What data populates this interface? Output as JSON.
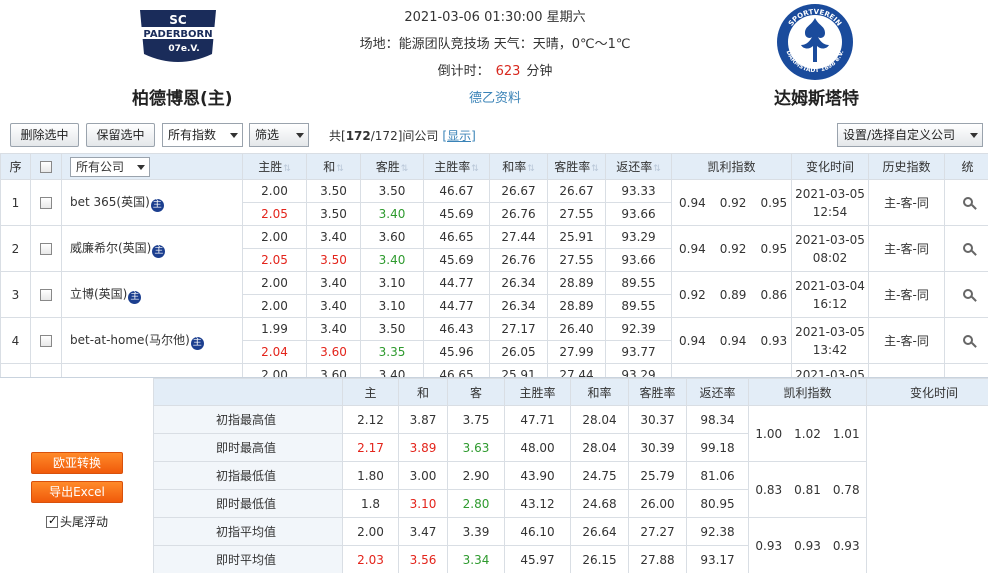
{
  "match": {
    "datetime": "2021-03-06 01:30:00 星期六",
    "venue_weather": "场地：能源团队竞技场 天气：天晴，0℃～1℃",
    "countdown_label": "倒计时：",
    "countdown_value": "623",
    "countdown_unit": "分钟",
    "league_link": "德乙资料",
    "home_team": "柏德博恩(主)",
    "away_team": "达姆斯塔特",
    "home_logo_text": [
      "SC",
      "PADERBORN",
      "07e.V."
    ],
    "away_logo_text": [
      "SPORTVEREIN",
      "DARMSTADT 1898 e.V."
    ]
  },
  "toolbar": {
    "delete_selected": "删除选中",
    "keep_selected": "保留选中",
    "index_select": "所有指数",
    "filter": "筛选",
    "count_prefix": "共[",
    "count_current": "172",
    "count_total": "/172]间公司",
    "show_link": "[显示]",
    "custom_company": "设置/选择自定义公司"
  },
  "table": {
    "headers": {
      "seq": "序",
      "company_dropdown": "所有公司",
      "home_win": "主胜",
      "draw": "和",
      "away_win": "客胜",
      "home_rate": "主胜率",
      "draw_rate": "和率",
      "away_rate": "客胜率",
      "return_rate": "返还率",
      "kelly": "凯利指数",
      "change_time": "变化时间",
      "history": "历史指数",
      "stat": "统"
    },
    "host_badge": "主",
    "rows": [
      {
        "seq": "1",
        "company": "bet 365(英国)",
        "initial": [
          "2.00",
          "3.50",
          "3.50",
          "46.67",
          "26.67",
          "26.67",
          "93.33"
        ],
        "live": [
          "2.05",
          "3.50",
          "3.40",
          "45.69",
          "26.76",
          "27.55",
          "93.66"
        ],
        "live_colors": [
          "red",
          "",
          "green"
        ],
        "kelly": [
          "0.94",
          "0.92",
          "0.95"
        ],
        "date": "2021-03-05",
        "time": "12:54",
        "history": "主-客-同"
      },
      {
        "seq": "2",
        "company": "威廉希尔(英国)",
        "initial": [
          "2.00",
          "3.40",
          "3.60",
          "46.65",
          "27.44",
          "25.91",
          "93.29"
        ],
        "live": [
          "2.05",
          "3.50",
          "3.40",
          "45.69",
          "26.76",
          "27.55",
          "93.66"
        ],
        "live_colors": [
          "red",
          "red",
          "green"
        ],
        "kelly": [
          "0.94",
          "0.92",
          "0.95"
        ],
        "date": "2021-03-05",
        "time": "08:02",
        "history": "主-客-同"
      },
      {
        "seq": "3",
        "company": "立博(英国)",
        "initial": [
          "2.00",
          "3.40",
          "3.10",
          "44.77",
          "26.34",
          "28.89",
          "89.55"
        ],
        "live": [
          "2.00",
          "3.40",
          "3.10",
          "44.77",
          "26.34",
          "28.89",
          "89.55"
        ],
        "live_colors": [
          "",
          "",
          ""
        ],
        "kelly": [
          "0.92",
          "0.89",
          "0.86"
        ],
        "date": "2021-03-04",
        "time": "16:12",
        "history": "主-客-同"
      },
      {
        "seq": "4",
        "company": "bet-at-home(马尔他)",
        "initial": [
          "1.99",
          "3.40",
          "3.50",
          "46.43",
          "27.17",
          "26.40",
          "92.39"
        ],
        "live": [
          "2.04",
          "3.60",
          "3.35",
          "45.96",
          "26.05",
          "27.99",
          "93.77"
        ],
        "live_colors": [
          "red",
          "red",
          "green"
        ],
        "kelly": [
          "0.94",
          "0.94",
          "0.93"
        ],
        "date": "2021-03-05",
        "time": "13:42",
        "history": "主-客-同"
      }
    ],
    "partial_row": [
      "2.00",
      "3.60",
      "3.40",
      "46.65",
      "25.91",
      "27.44",
      "93.29",
      "2021-03-05"
    ]
  },
  "side": {
    "eu_asia": "欧亚转换",
    "export_excel": "导出Excel",
    "float_label": "头尾浮动"
  },
  "summary": {
    "headers": {
      "home": "主",
      "draw": "和",
      "away": "客",
      "home_rate": "主胜率",
      "draw_rate": "和率",
      "away_rate": "客胜率",
      "return_rate": "返还率",
      "kelly": "凯利指数",
      "change_time": "变化时间"
    },
    "rows": [
      {
        "label": "初指最高值",
        "values": [
          "2.12",
          "3.87",
          "3.75",
          "47.71",
          "28.04",
          "30.37",
          "98.34"
        ],
        "colors": [
          "",
          "",
          ""
        ]
      },
      {
        "label": "即时最高值",
        "values": [
          "2.17",
          "3.89",
          "3.63",
          "48.00",
          "28.04",
          "30.39",
          "99.18"
        ],
        "colors": [
          "red",
          "red",
          "green"
        ]
      },
      {
        "label": "初指最低值",
        "values": [
          "1.80",
          "3.00",
          "2.90",
          "43.90",
          "24.75",
          "25.79",
          "81.06"
        ],
        "colors": [
          "",
          "",
          ""
        ]
      },
      {
        "label": "即时最低值",
        "values": [
          "1.8",
          "3.10",
          "2.80",
          "43.12",
          "24.68",
          "26.00",
          "80.95"
        ],
        "colors": [
          "",
          "red",
          "green"
        ]
      },
      {
        "label": "初指平均值",
        "values": [
          "2.00",
          "3.47",
          "3.39",
          "46.10",
          "26.64",
          "27.27",
          "92.38"
        ],
        "colors": [
          "",
          "",
          ""
        ]
      },
      {
        "label": "即时平均值",
        "values": [
          "2.03",
          "3.56",
          "3.34",
          "45.97",
          "26.15",
          "27.88",
          "93.17"
        ],
        "colors": [
          "red",
          "red",
          "green"
        ]
      }
    ],
    "kelly_groups": [
      [
        "1.00",
        "1.02",
        "1.01"
      ],
      [
        "0.83",
        "0.81",
        "0.78"
      ],
      [
        "0.93",
        "0.93",
        "0.93"
      ]
    ]
  },
  "colors": {
    "red": "#e3241b",
    "green": "#2e9a2e",
    "header_bg": "#e3edf7",
    "orange": "#f05a0a",
    "link": "#3a83b7"
  }
}
